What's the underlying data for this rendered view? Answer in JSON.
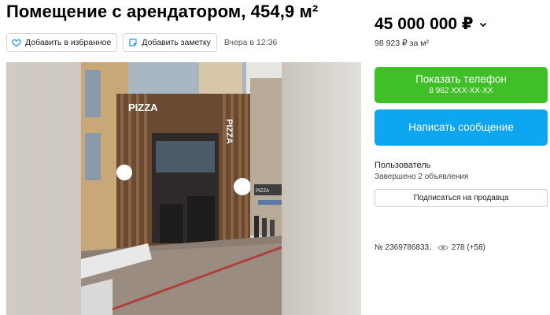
{
  "listing": {
    "title": "Помещение с арендатором, 454,9 м²",
    "actions": {
      "favorite_label": "Добавить в избранное",
      "note_label": "Добавить заметку"
    },
    "date": "Вчера в 12:36",
    "photo": {
      "sign_left": "PIZZA",
      "sign_right": "PIZZA",
      "banner": "PIZZA"
    }
  },
  "sidebar": {
    "price": "45 000 000 ₽",
    "price_per_m": "98 923 ₽ за м²",
    "phone_button": {
      "label": "Показать телефон",
      "masked_number": "8 962 XXX-XX-XX"
    },
    "message_button": "Написать сообщение",
    "seller": {
      "name": "Пользователь",
      "status": "Завершено 2 объявления"
    },
    "subscribe_button": "Подписаться на продавца",
    "ad_number": "№ 2369786833,",
    "views": "278 (+58)"
  },
  "colors": {
    "phone_button": "#3fc027",
    "message_button": "#0fa6f1",
    "favorite_icon": "#1a8cff",
    "note_icon": "#1a8cff"
  },
  "icons": [
    "heart-icon",
    "note-icon",
    "chevron-down-icon",
    "eye-icon"
  ]
}
